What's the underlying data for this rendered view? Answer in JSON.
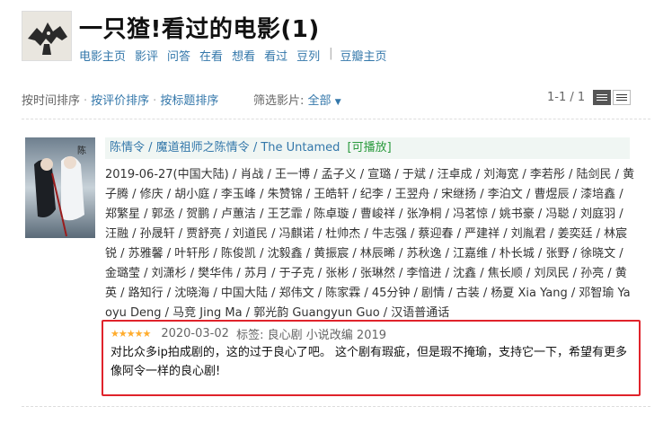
{
  "header": {
    "title": "一只猹!看过的电影(1)",
    "avatar_icon": "dragon-silhouette-avatar-icon"
  },
  "nav": {
    "items": [
      "电影主页",
      "影评",
      "问答",
      "在看",
      "想看",
      "看过",
      "豆列"
    ],
    "extra": "豆瓣主页"
  },
  "sort": {
    "by_time": "按时间排序",
    "by_rating": "按评价排序",
    "by_title": "按标题排序"
  },
  "filter": {
    "label": "筛选影片:",
    "value": "全部"
  },
  "pager": {
    "text": "1-1 / 1",
    "view_modes": [
      "list-icon",
      "compact-list-icon"
    ]
  },
  "item": {
    "title_main": "陈情令",
    "title_alt": "魔道祖师之陈情令",
    "title_en": "The Untamed",
    "playable": "[可播放]",
    "intro": "2019-06-27(中国大陆) / 肖战 / 王一博 / 孟子义 / 宣璐 / 于斌 / 汪卓成 / 刘海宽 / 李若彤 / 陆剑民 / 黄子腾 / 修庆 / 胡小庭 / 李玉峰 / 朱赞锦 / 王皓轩 / 纪李 / 王翌舟 / 宋继扬 / 李泊文 / 曹煜辰 / 漆培鑫 / 郑繁星 / 郭丞 / 贺鹏 / 卢蕙洁 / 王艺霏 / 陈卓璇 / 曹峻祥 / 张净桐 / 冯茗惊 / 姚书豪 / 冯聪 / 刘庭羽 / 汪融 / 孙晟轩 / 贾舒亮 / 刘道民 / 冯麒诺 / 杜帅杰 / 牛志强 / 蔡迎春 / 严建祥 / 刘胤君 / 姜奕廷 / 林宸锐 / 苏雅馨 / 叶轩彤 / 陈俊凯 / 沈毅鑫 / 黄振宸 / 林辰晞 / 苏秋逸 / 江嘉维 / 朴长城 / 张野 / 徐晓文 / 金璐莹 / 刘潇杉 / 樊华伟 / 苏月 / 于子克 / 张彬 / 张琳然 / 李愔进 / 沈鑫 / 焦长顺 / 刘凤民 / 孙亮 / 黄英 / 路知行 / 沈晓海 / 中国大陆 / 郑伟文 / 陈家霖 / 45分钟 / 剧情 / 古装 / 杨夏 Xia Yang / 邓智瑜 Yaoyu Deng / 马竞 Jing Ma / 郭光韵 Guangyun Guo / 汉语普通话"
  },
  "review": {
    "rating": 5,
    "rating_max": 5,
    "stars": "★★★★★",
    "date": "2020-03-02",
    "tags_label": "标签:",
    "tags": "良心剧 小说改编 2019",
    "comment": "对比众多ip拍成剧的，这的过于良心了吧。 这个剧有瑕疵，但是瑕不掩瑜，支持它一下，希望有更多像阿令一样的良心剧!",
    "highlight_color": "#e0232b"
  },
  "colors": {
    "link": "#3377aa",
    "play": "#2b9b3e",
    "star": "#ffac2d",
    "title_bg": "#f0f6f3"
  }
}
